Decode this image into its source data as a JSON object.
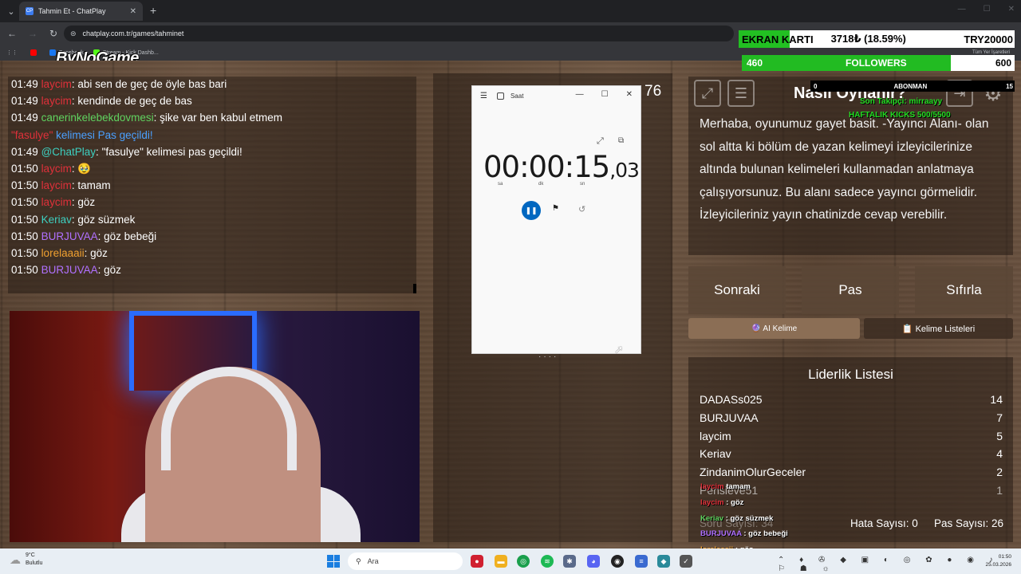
{
  "browser": {
    "tab_title": "Tahmin Et - ChatPlay",
    "tab_favicon": "CP",
    "url": "chatplay.com.tr/games/tahminet",
    "bookmarks": [
      "Facebook",
      "Stream - Kick Dashb..."
    ],
    "bookmarks_right": "Tüm Yer İşaretleri"
  },
  "brand_logo": "ByNoGame",
  "chat": [
    {
      "time": "01:49",
      "user": "laycim",
      "color": "red",
      "sep": ": ",
      "msg": "abi sen de geç de öyle bas bari"
    },
    {
      "time": "01:49",
      "user": "laycim",
      "color": "red",
      "sep": ": ",
      "msg": "kendinde de geç de bas"
    },
    {
      "time": "01:49",
      "user": "canerinkelebekdovmesi",
      "color": "green",
      "sep": ": ",
      "msg": "şike var ben kabul etmem"
    },
    {
      "time": "",
      "user": "\"fasulye\"",
      "color": "red",
      "sep": " ",
      "msg": "kelimesi Pas geçildi!"
    },
    {
      "time": "01:49",
      "user": "@ChatPlay",
      "color": "teal",
      "sep": ": ",
      "msg": "\"fasulye\" kelimesi pas geçildi!"
    },
    {
      "time": "01:50",
      "user": "laycim",
      "color": "red",
      "sep": ": ",
      "msg": "🥹"
    },
    {
      "time": "01:50",
      "user": "laycim",
      "color": "red",
      "sep": ": ",
      "msg": "tamam"
    },
    {
      "time": "01:50",
      "user": "laycim",
      "color": "red",
      "sep": ": ",
      "msg": "göz"
    },
    {
      "time": "01:50",
      "user": "Keriav",
      "color": "teal",
      "sep": ": ",
      "msg": "göz süzmek"
    },
    {
      "time": "01:50",
      "user": "BURJUVAA",
      "color": "purple",
      "sep": ": ",
      "msg": "göz bebeği"
    },
    {
      "time": "01:50",
      "user": "lorelaaaii",
      "color": "orange",
      "sep": ": ",
      "msg": "göz"
    },
    {
      "time": "01:50",
      "user": "BURJUVAA",
      "color": "purple",
      "sep": ": ",
      "msg": "göz"
    }
  ],
  "timer_counter": "76",
  "saat": {
    "title": "Saat",
    "time_main": "00:00:15",
    "time_cs": ",03",
    "unit_h": "sa",
    "unit_m": "dk",
    "unit_s": "sn"
  },
  "how_to": {
    "title": "Nasıl Oynanır?",
    "text": "Merhaba, oyunumuz gayet basit. -Yayıncı Alanı- olan sol altta ki bölüm de yazan kelimeyi izleyicilerinize altında bulunan kelimeleri kullanmadan anlatmaya çalışıyorsunuz. Bu alanı sadece yayıncı görmelidir. İzleyicileriniz yayın chatinizde cevap verebilir."
  },
  "actions": {
    "next": "Sonraki",
    "pass": "Pas",
    "reset": "Sıfırla",
    "ai_word": "🔮 AI Kelime",
    "word_lists": "📋 Kelime Listeleri"
  },
  "leaderboard": {
    "title": "Liderlik Listesi",
    "rows": [
      {
        "name": "DADASs025",
        "score": "14"
      },
      {
        "name": "BURJUVAA",
        "score": "7"
      },
      {
        "name": "laycim",
        "score": "5"
      },
      {
        "name": "Keriav",
        "score": "4"
      },
      {
        "name": "ZindanimOlurGeceler",
        "score": "2"
      },
      {
        "name": "Pensieve51",
        "score": "1"
      }
    ],
    "question_count": "Soru Sayısı: 34",
    "error_count": "Hata Sayısı: 0",
    "pass_count": "Pas Sayısı: 26"
  },
  "overlay": {
    "ekran_label": "EKRAN KARTI",
    "ekran_value": "3718₺ (18.59%)",
    "ekran_goal": "TRY20000",
    "ekran_progress": 0.1859,
    "followers_current": "460",
    "followers_label": "FOLLOWERS",
    "followers_goal": "600",
    "followers_progress": 0.7667,
    "abonman_left": "0",
    "abonman_label": "ABONMAN",
    "abonman_right": "15",
    "son_takipci": "Son Takipçi: mirraayy",
    "haftalik": "HAFTALIK KICKS 500/5500",
    "chat": [
      {
        "user": "laycim",
        "color": "red",
        "msg": " tamam"
      },
      {
        "user": "laycim",
        "color": "red",
        "msg": " : göz"
      },
      {
        "user": "Keriav",
        "color": "green",
        "msg": " : göz süzmek"
      },
      {
        "user": "BURJUVAA",
        "color": "purple",
        "msg": " : göz bebeği"
      },
      {
        "user": "lorelaaaii",
        "color": "orange",
        "msg": " : göz"
      },
      {
        "user": "BURJUVAA",
        "color": "purple",
        "msg": " : göz"
      }
    ]
  },
  "taskbar": {
    "temp": "9°C",
    "weather": "Bulutlu",
    "search": "Ara",
    "time": "01:50",
    "date": "25.03.2026"
  }
}
